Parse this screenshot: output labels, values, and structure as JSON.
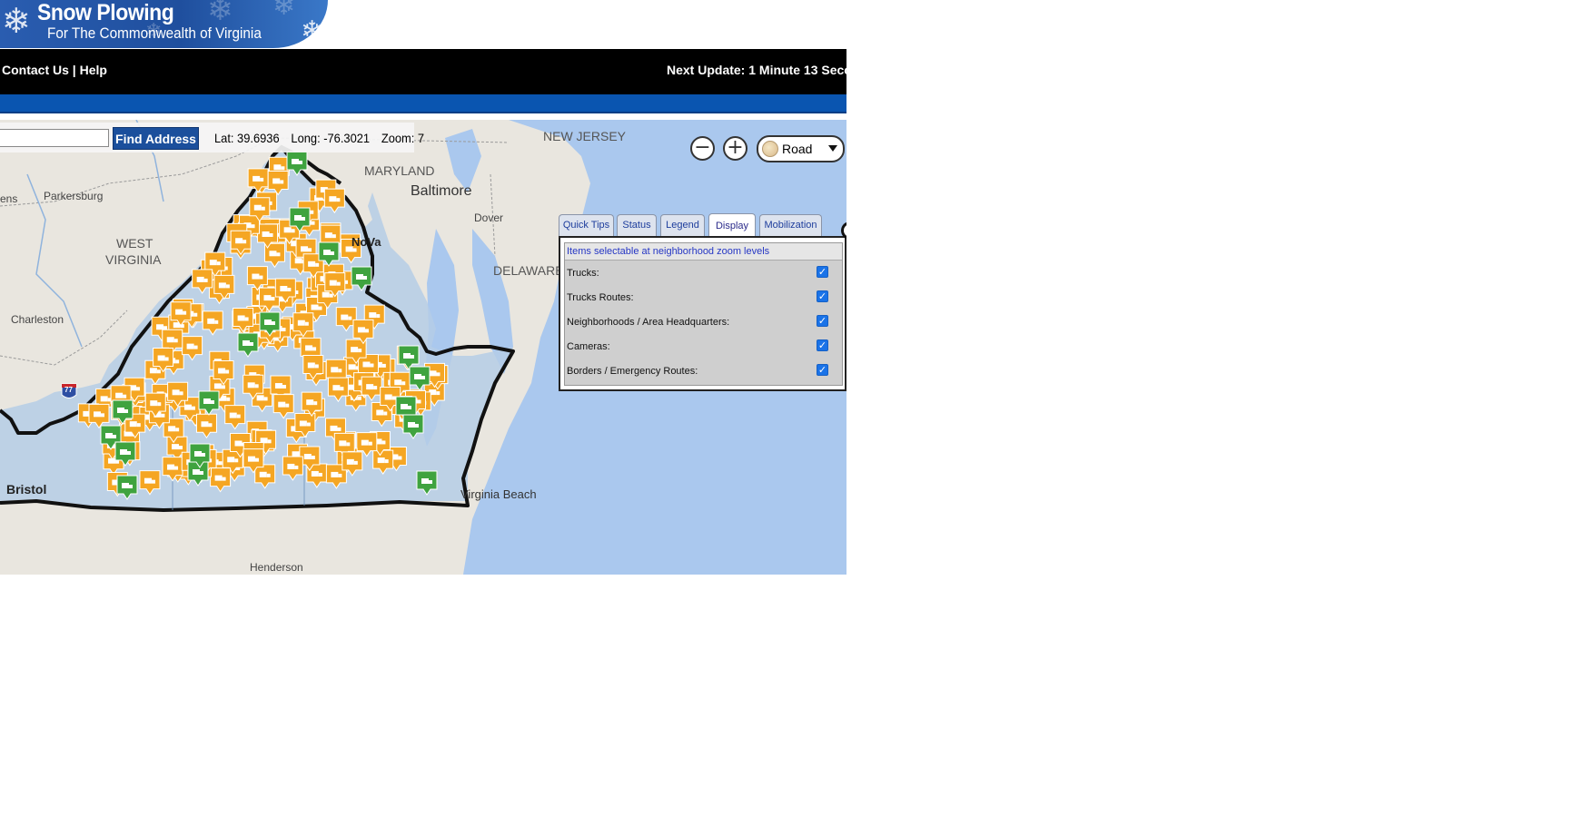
{
  "banner": {
    "title": "Snow Plowing",
    "subtitle": "For The Commonwealth of Virginia",
    "icon": "snowflake-icon"
  },
  "topbar": {
    "contact_label": "Contact Us",
    "separator": " | ",
    "help_label": "Help",
    "next_update": "Next Update: 1 Minute 13 Secon"
  },
  "search": {
    "value": "",
    "placeholder": "",
    "button_label": "Find Address"
  },
  "coords": {
    "lat": "Lat: 39.6936",
    "long": "Long: -76.3021",
    "zoom": "Zoom: 7"
  },
  "map_controls": {
    "zoom_out": "−",
    "zoom_in": "+",
    "map_type": "Road"
  },
  "map_labels": {
    "new_jersey": "NEW JERSEY",
    "maryland": "MARYLAND",
    "baltimore": "Baltimore",
    "dover": "Dover",
    "delaware": "DELAWARE",
    "nova": "NoVa",
    "west_virginia_1": "WEST",
    "west_virginia_2": "VIRGINIA",
    "parkersburg": "Parkersburg",
    "ens": "ens",
    "charleston": "Charleston",
    "bristol": "Bristol",
    "virginia_beach": "Virginia Beach",
    "henderson": "Henderson",
    "interstate": "77"
  },
  "panel": {
    "tabs": [
      {
        "label": "Quick Tips"
      },
      {
        "label": "Status"
      },
      {
        "label": "Legend"
      },
      {
        "label": "Display"
      },
      {
        "label": "Mobilization"
      }
    ],
    "active_tab": "Display",
    "header": "Items selectable at neighborhood zoom levels",
    "options": [
      {
        "label": "Trucks:",
        "checked": true
      },
      {
        "label": "Trucks Routes:",
        "checked": true
      },
      {
        "label": "Neighborhoods / Area Headquarters:",
        "checked": true
      },
      {
        "label": "Cameras:",
        "checked": true
      },
      {
        "label": "Borders / Emergency Routes:",
        "checked": true
      }
    ]
  },
  "colors": {
    "truck_orange": "#f5a623",
    "truck_green": "#3fa33f",
    "water": "#aac8ee",
    "land": "#e9e6df",
    "virginia_fill": "#b5cde6",
    "header_blue": "#0a55b0",
    "button_blue": "#1b4f9c"
  },
  "markers": {
    "orange_icon": "plow-truck-icon",
    "green_icon": "plow-truck-icon"
  }
}
